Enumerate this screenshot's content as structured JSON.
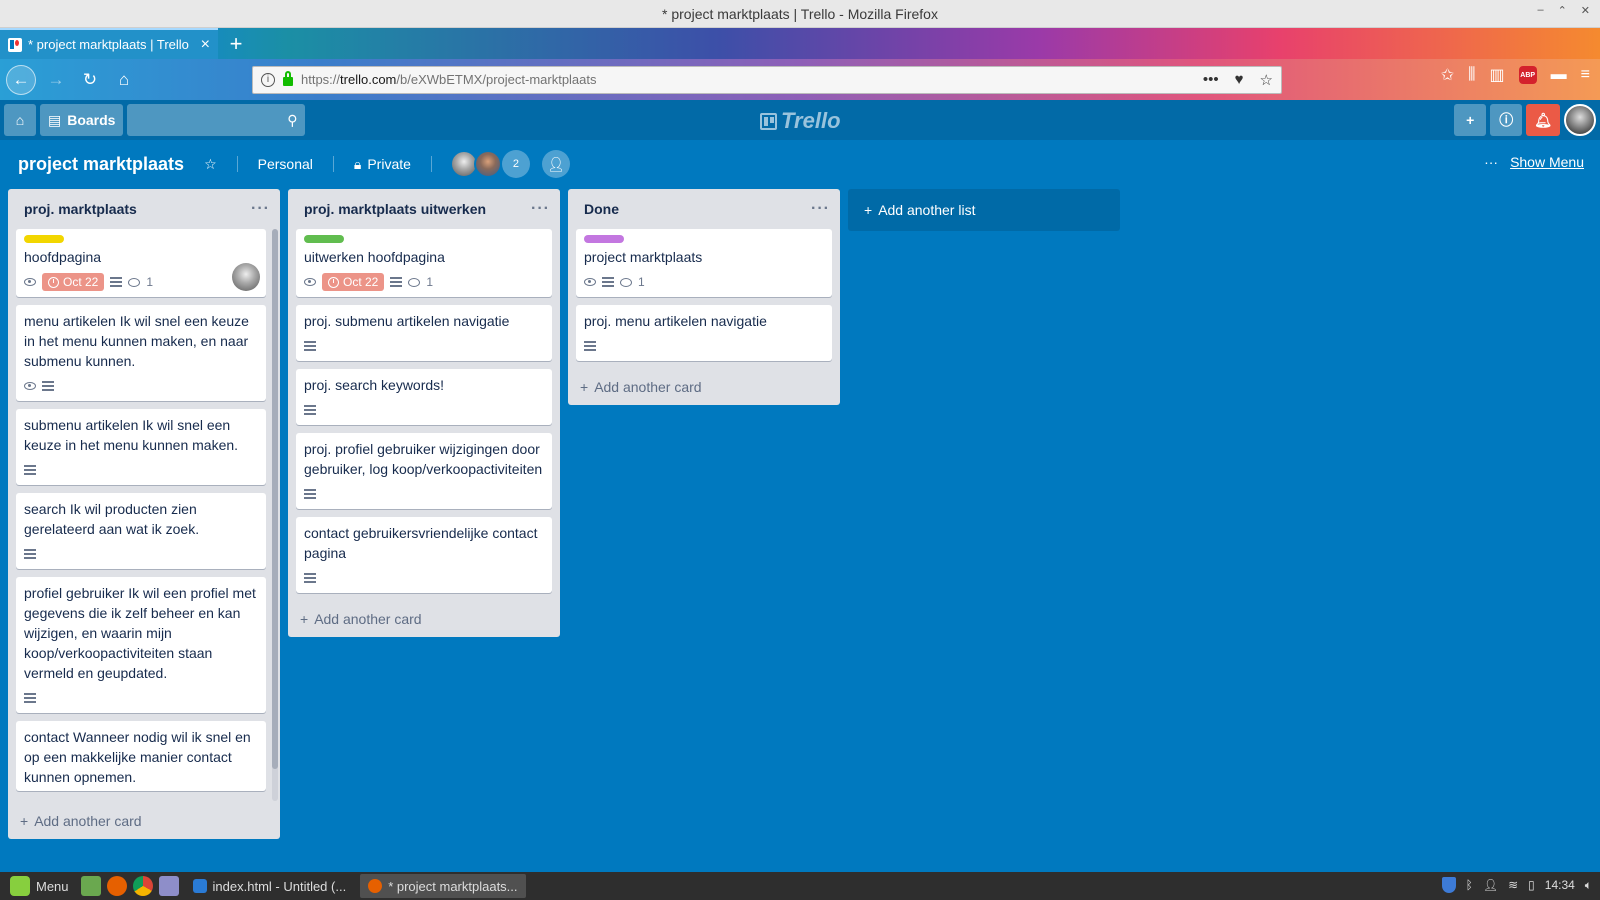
{
  "os": {
    "window_title": "* project marktplaats | Trello - Mozilla Firefox",
    "controls": [
      "–",
      "⌃",
      "✕"
    ]
  },
  "browser": {
    "tab_title": "* project marktplaats | Trello",
    "new_tab": "+",
    "url_prefix": "https://",
    "url_host": "trello.com",
    "url_path": "/b/eXWbETMX/project-marktplaats",
    "abp": "ABP"
  },
  "trello_header": {
    "boards_label": "Boards",
    "logo_text": "Trello"
  },
  "board": {
    "title": "project marktplaats",
    "team_label": "Personal",
    "visibility_label": "Private",
    "member_count": "2",
    "show_menu_dots": "···",
    "show_menu_label": "Show Menu"
  },
  "lists": [
    {
      "title": "proj. marktplaats",
      "add_card": "Add another card",
      "cards": [
        {
          "title": "hoofdpagina",
          "label_color": "#f2d600",
          "watch": true,
          "due": "Oct 22",
          "desc": true,
          "comments": "1",
          "member": true
        },
        {
          "title": "menu artikelen Ik wil snel een keuze in het menu kunnen maken, en naar submenu kunnen.",
          "watch": true,
          "desc": true
        },
        {
          "title": "submenu artikelen Ik wil snel een keuze in het menu kunnen maken.",
          "desc": true
        },
        {
          "title": "search Ik wil producten zien gerelateerd aan wat ik zoek.",
          "desc": true
        },
        {
          "title": "profiel gebruiker Ik wil een profiel met gegevens die ik zelf beheer en kan wijzigen, en waarin mijn koop/verkoopactiviteiten staan vermeld en geupdated.",
          "desc": true
        },
        {
          "title": "contact Wanneer nodig wil ik snel en op een makkelijke manier contact kunnen opnemen."
        }
      ]
    },
    {
      "title": "proj. marktplaats uitwerken",
      "add_card": "Add another card",
      "cards": [
        {
          "title": "uitwerken hoofdpagina",
          "label_color": "#61bd4f",
          "watch": true,
          "due": "Oct 22",
          "desc": true,
          "comments": "1"
        },
        {
          "title": "proj. submenu artikelen navigatie",
          "desc": true
        },
        {
          "title": "proj. search keywords!",
          "desc": true
        },
        {
          "title": "proj. profiel gebruiker wijzigingen door gebruiker, log koop/verkoopactiviteiten",
          "desc": true
        },
        {
          "title": "contact gebruikersvriendelijke contact pagina",
          "desc": true
        }
      ]
    },
    {
      "title": "Done",
      "add_card": "Add another card",
      "cards": [
        {
          "title": "project marktplaats",
          "label_color": "#c377e0",
          "watch": true,
          "desc": true,
          "comments": "1"
        },
        {
          "title": "proj. menu artikelen navigatie",
          "desc": true
        }
      ]
    }
  ],
  "add_list_label": "Add another list",
  "taskbar": {
    "menu_label": "Menu",
    "windows": [
      {
        "title": "index.html - Untitled (...",
        "active": false
      },
      {
        "title": "* project marktplaats...",
        "active": true
      }
    ],
    "clock": "14:34"
  },
  "colors": {
    "board_bg": "#0079bf",
    "header_bg": "#026aa7",
    "list_bg": "#dfe1e6",
    "due_badge": "#ec9488",
    "notification": "#eb5a46"
  }
}
